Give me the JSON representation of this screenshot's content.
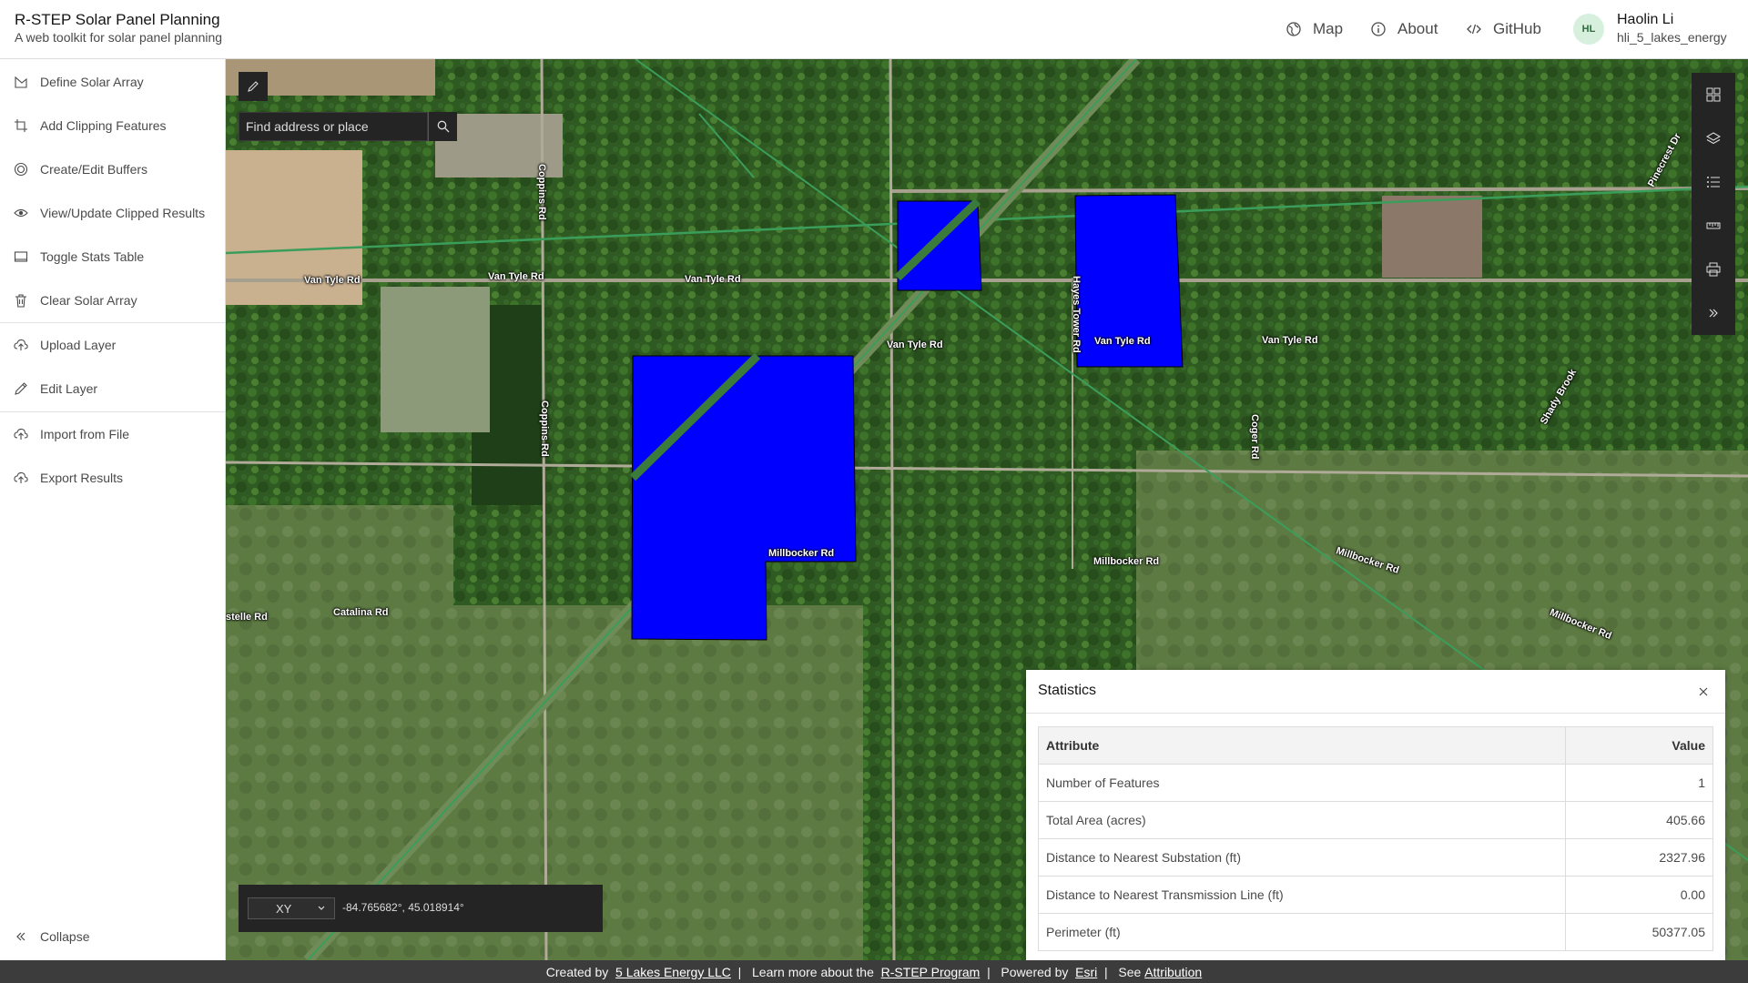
{
  "header": {
    "title": "R-STEP Solar Panel Planning",
    "subtitle": "A web toolkit for solar panel planning",
    "nav": {
      "map": "Map",
      "about": "About",
      "github": "GitHub"
    },
    "user": {
      "initials": "HL",
      "name": "Haolin Li",
      "username": "hli_5_lakes_energy"
    }
  },
  "sidebar": {
    "items": [
      {
        "label": "Define Solar Array",
        "icon": "polygon-icon"
      },
      {
        "label": "Add Clipping Features",
        "icon": "crop-icon"
      },
      {
        "label": "Create/Edit Buffers",
        "icon": "buffer-icon"
      },
      {
        "label": "View/Update Clipped Results",
        "icon": "eye-icon"
      },
      {
        "label": "Toggle Stats Table",
        "icon": "table-icon"
      },
      {
        "label": "Clear Solar Array",
        "icon": "trash-icon"
      },
      {
        "label": "Upload Layer",
        "icon": "upload-icon"
      },
      {
        "label": "Edit Layer",
        "icon": "pencil-icon"
      },
      {
        "label": "Import from File",
        "icon": "import-icon"
      },
      {
        "label": "Export Results",
        "icon": "export-icon"
      }
    ],
    "collapse_label": "Collapse"
  },
  "map": {
    "search_placeholder": "Find address or place",
    "coordinate": {
      "format": "XY",
      "value": "-84.765682°, 45.018914°"
    },
    "road_labels": {
      "van_tyle_1": "Van Tyle Rd",
      "van_tyle_2": "Van Tyle Rd",
      "van_tyle_3": "Van Tyle Rd",
      "van_tyle_4": "Van Tyle Rd",
      "van_tyle_5": "Van Tyle Rd",
      "van_tyle_6": "Van Tyle Rd",
      "coppins_1": "Coppins Rd",
      "coppins_2": "Coppins Rd",
      "hayes_tower": "Hayes Tower Rd",
      "coger": "Coger Rd",
      "millbocker_1": "Millbocker Rd",
      "millbocker_2": "Millbocker Rd",
      "millbocker_3": "Millbocker Rd",
      "millbocker_4": "Millbocker Rd",
      "catalina": "Catalina Rd",
      "estelle": "stelle Rd",
      "pinecrest": "Pinecrest Dr",
      "shady_brook": "Shady Brook"
    },
    "solar_fill_color": "#0000ff"
  },
  "statistics": {
    "title": "Statistics",
    "columns": [
      "Attribute",
      "Value"
    ],
    "rows": [
      {
        "attribute": "Number of Features",
        "value": "1"
      },
      {
        "attribute": "Total Area (acres)",
        "value": "405.66"
      },
      {
        "attribute": "Distance to Nearest Substation (ft)",
        "value": "2327.96"
      },
      {
        "attribute": "Distance to Nearest Transmission Line (ft)",
        "value": "0.00"
      },
      {
        "attribute": "Perimeter (ft)",
        "value": "50377.05"
      }
    ]
  },
  "footer": {
    "created_by": "Created by",
    "company": "5 Lakes Energy LLC",
    "learn_more": "Learn more about the",
    "program": "R-STEP Program",
    "powered_by": "Powered by",
    "esri": "Esri",
    "see": "See",
    "attribution": "Attribution"
  }
}
